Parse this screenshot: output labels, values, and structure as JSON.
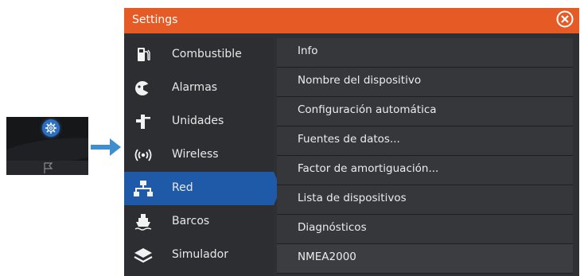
{
  "window": {
    "title": "Settings",
    "close_icon": "close-circle-icon",
    "accent": "#e65a25",
    "selected_color": "#1f5aa8"
  },
  "thumbnail": {
    "gear_icon": "gear-icon",
    "flag_icon": "flag-icon"
  },
  "arrow_icon": "arrow-right-icon",
  "menu": {
    "items": [
      {
        "label": "Combustible",
        "icon": "fuel-pump-icon",
        "selected": false
      },
      {
        "label": "Alarmas",
        "icon": "alarm-horn-icon",
        "selected": false
      },
      {
        "label": "Unidades",
        "icon": "units-icon",
        "selected": false
      },
      {
        "label": "Wireless",
        "icon": "wireless-icon",
        "selected": false
      },
      {
        "label": "Red",
        "icon": "network-icon",
        "selected": true
      },
      {
        "label": "Barcos",
        "icon": "ship-icon",
        "selected": false
      },
      {
        "label": "Simulador",
        "icon": "layers-icon",
        "selected": false
      }
    ]
  },
  "content": {
    "items": [
      {
        "label": "Info"
      },
      {
        "label": "Nombre del dispositivo"
      },
      {
        "label": "Configuración automática"
      },
      {
        "label": "Fuentes de datos..."
      },
      {
        "label": "Factor de amortiguación..."
      },
      {
        "label": "Lista de dispositivos"
      },
      {
        "label": "Diagnósticos"
      },
      {
        "label": "NMEA2000"
      }
    ]
  }
}
